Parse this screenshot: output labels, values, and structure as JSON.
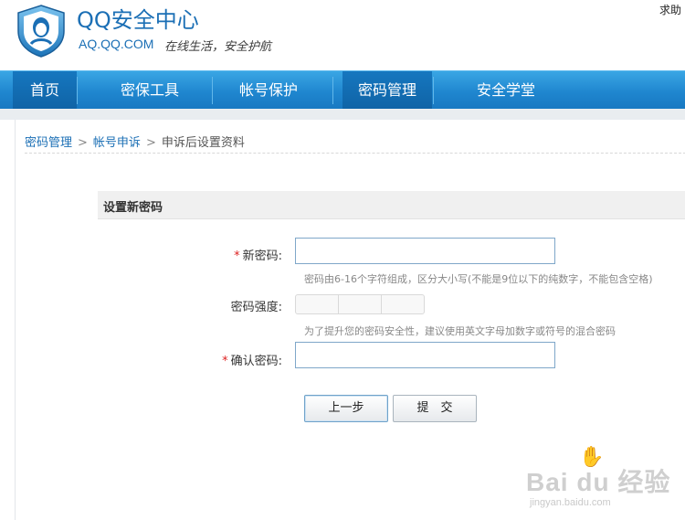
{
  "header": {
    "brand_title": "QQ安全中心",
    "brand_url": "AQ.QQ.COM",
    "slogan": "在线生活，安全护航",
    "help_link": "求助",
    "brand_color": "#1b6fb5"
  },
  "nav": {
    "items": [
      {
        "label": "首页",
        "active": true
      },
      {
        "label": "密保工具",
        "active": false
      },
      {
        "label": "帐号保护",
        "active": false
      },
      {
        "label": "密码管理",
        "active": true
      },
      {
        "label": "安全学堂",
        "active": false
      }
    ],
    "bar_color": "#1f86cf"
  },
  "breadcrumb": {
    "items": [
      "密码管理",
      "帐号申诉",
      "申诉后设置资料"
    ],
    "separator": ">"
  },
  "form": {
    "section_title": "设置新密码",
    "new_password_label": "新密码:",
    "new_password_value": "",
    "new_password_hint": "密码由6-16个字符组成，区分大小写(不能是9位以下的纯数字，不能包含空格)",
    "strength_label": "密码强度:",
    "strength_hint": "为了提升您的密码安全性，建议使用英文字母加数字或符号的混合密码",
    "confirm_label": "确认密码:",
    "confirm_value": "",
    "required_mark": "*",
    "prev_button": "上一步",
    "submit_button": "提　交"
  },
  "watermark": {
    "text": "Bai du 经验",
    "url": "jingyan.baidu.com"
  }
}
